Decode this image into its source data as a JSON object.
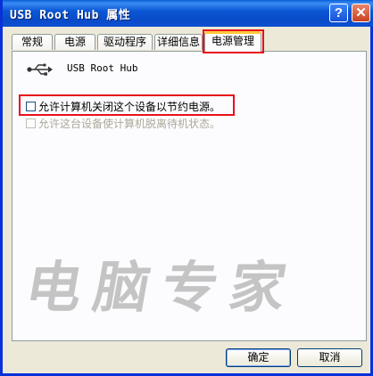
{
  "window": {
    "title": "USB Root Hub 属性",
    "help_glyph": "?",
    "close_glyph": "✕"
  },
  "tabs": [
    {
      "label": "常规"
    },
    {
      "label": "电源"
    },
    {
      "label": "驱动程序"
    },
    {
      "label": "详细信息"
    },
    {
      "label": "电源管理",
      "active": true
    }
  ],
  "device": {
    "icon": "usb-icon",
    "name": "USB Root Hub"
  },
  "options": {
    "allow_power_off": {
      "label": "允许计算机关闭这个设备以节约电源。",
      "checked": false,
      "enabled": true
    },
    "allow_wake": {
      "label": "允许这台设备使计算机脱离待机状态。",
      "checked": false,
      "enabled": false
    }
  },
  "watermark": "电脑专家",
  "buttons": {
    "ok": "确定",
    "cancel": "取消"
  },
  "colors": {
    "highlight": "#e8101b",
    "titlebar": "#0a5fd8",
    "active_tab_accent": "#ffc73c"
  }
}
